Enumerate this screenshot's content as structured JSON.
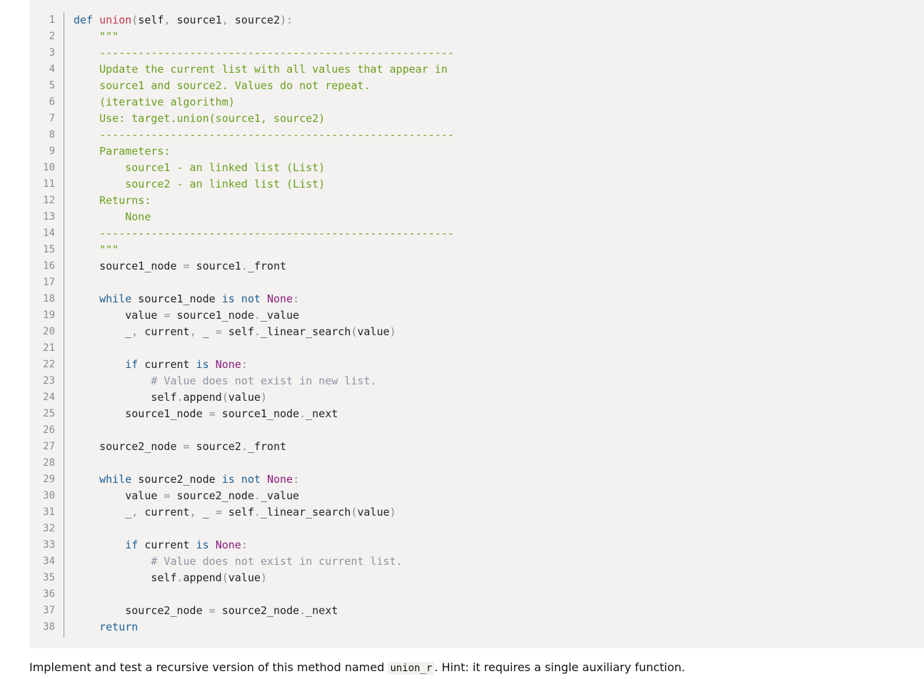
{
  "code": {
    "lines": [
      {
        "n": "1",
        "segs": [
          [
            "kw",
            "def "
          ],
          [
            "fn",
            "union"
          ],
          [
            "pun",
            "("
          ],
          [
            "txt",
            "self"
          ],
          [
            "pun",
            ", "
          ],
          [
            "txt",
            "source1"
          ],
          [
            "pun",
            ", "
          ],
          [
            "txt",
            "source2"
          ],
          [
            "pun",
            "):"
          ]
        ]
      },
      {
        "n": "2",
        "segs": [
          [
            "str",
            "    \"\"\""
          ]
        ]
      },
      {
        "n": "3",
        "segs": [
          [
            "str",
            "    -------------------------------------------------------"
          ]
        ]
      },
      {
        "n": "4",
        "segs": [
          [
            "str",
            "    Update the current list with all values that appear in"
          ]
        ]
      },
      {
        "n": "5",
        "segs": [
          [
            "str",
            "    source1 and source2. Values do not repeat."
          ]
        ]
      },
      {
        "n": "6",
        "segs": [
          [
            "str",
            "    (iterative algorithm)"
          ]
        ]
      },
      {
        "n": "7",
        "segs": [
          [
            "str",
            "    Use: target.union(source1, source2)"
          ]
        ]
      },
      {
        "n": "8",
        "segs": [
          [
            "str",
            "    -------------------------------------------------------"
          ]
        ]
      },
      {
        "n": "9",
        "segs": [
          [
            "str",
            "    Parameters:"
          ]
        ]
      },
      {
        "n": "10",
        "segs": [
          [
            "str",
            "        source1 - an linked list (List)"
          ]
        ]
      },
      {
        "n": "11",
        "segs": [
          [
            "str",
            "        source2 - an linked list (List)"
          ]
        ]
      },
      {
        "n": "12",
        "segs": [
          [
            "str",
            "    Returns:"
          ]
        ]
      },
      {
        "n": "13",
        "segs": [
          [
            "str",
            "        None"
          ]
        ]
      },
      {
        "n": "14",
        "segs": [
          [
            "str",
            "    -------------------------------------------------------"
          ]
        ]
      },
      {
        "n": "15",
        "segs": [
          [
            "str",
            "    \"\"\""
          ]
        ]
      },
      {
        "n": "16",
        "segs": [
          [
            "txt",
            "    source1_node "
          ],
          [
            "pun",
            "="
          ],
          [
            "txt",
            " source1"
          ],
          [
            "pun",
            "."
          ],
          [
            "txt",
            "_front"
          ]
        ]
      },
      {
        "n": "17",
        "segs": []
      },
      {
        "n": "18",
        "segs": [
          [
            "kw",
            "    while"
          ],
          [
            "txt",
            " source1_node "
          ],
          [
            "kw",
            "is not"
          ],
          [
            "txt",
            " "
          ],
          [
            "cst",
            "None"
          ],
          [
            "pun",
            ":"
          ]
        ]
      },
      {
        "n": "19",
        "segs": [
          [
            "txt",
            "        value "
          ],
          [
            "pun",
            "="
          ],
          [
            "txt",
            " source1_node"
          ],
          [
            "pun",
            "."
          ],
          [
            "txt",
            "_value"
          ]
        ]
      },
      {
        "n": "20",
        "segs": [
          [
            "txt",
            "        _"
          ],
          [
            "pun",
            ","
          ],
          [
            "txt",
            " current"
          ],
          [
            "pun",
            ","
          ],
          [
            "txt",
            " _ "
          ],
          [
            "pun",
            "="
          ],
          [
            "txt",
            " self"
          ],
          [
            "pun",
            "."
          ],
          [
            "txt",
            "_linear_search"
          ],
          [
            "pun",
            "("
          ],
          [
            "txt",
            "value"
          ],
          [
            "pun",
            ")"
          ]
        ]
      },
      {
        "n": "21",
        "segs": []
      },
      {
        "n": "22",
        "segs": [
          [
            "kw",
            "        if"
          ],
          [
            "txt",
            " current "
          ],
          [
            "kw",
            "is"
          ],
          [
            "txt",
            " "
          ],
          [
            "cst",
            "None"
          ],
          [
            "pun",
            ":"
          ]
        ]
      },
      {
        "n": "23",
        "segs": [
          [
            "cmt",
            "            # Value does not exist in new list."
          ]
        ]
      },
      {
        "n": "24",
        "segs": [
          [
            "txt",
            "            self"
          ],
          [
            "pun",
            "."
          ],
          [
            "txt",
            "append"
          ],
          [
            "pun",
            "("
          ],
          [
            "txt",
            "value"
          ],
          [
            "pun",
            ")"
          ]
        ]
      },
      {
        "n": "25",
        "segs": [
          [
            "txt",
            "        source1_node "
          ],
          [
            "pun",
            "="
          ],
          [
            "txt",
            " source1_node"
          ],
          [
            "pun",
            "."
          ],
          [
            "txt",
            "_next"
          ]
        ]
      },
      {
        "n": "26",
        "segs": []
      },
      {
        "n": "27",
        "segs": [
          [
            "txt",
            "    source2_node "
          ],
          [
            "pun",
            "="
          ],
          [
            "txt",
            " source2"
          ],
          [
            "pun",
            "."
          ],
          [
            "txt",
            "_front"
          ]
        ]
      },
      {
        "n": "28",
        "segs": []
      },
      {
        "n": "29",
        "segs": [
          [
            "kw",
            "    while"
          ],
          [
            "txt",
            " source2_node "
          ],
          [
            "kw",
            "is not"
          ],
          [
            "txt",
            " "
          ],
          [
            "cst",
            "None"
          ],
          [
            "pun",
            ":"
          ]
        ]
      },
      {
        "n": "30",
        "segs": [
          [
            "txt",
            "        value "
          ],
          [
            "pun",
            "="
          ],
          [
            "txt",
            " source2_node"
          ],
          [
            "pun",
            "."
          ],
          [
            "txt",
            "_value"
          ]
        ]
      },
      {
        "n": "31",
        "segs": [
          [
            "txt",
            "        _"
          ],
          [
            "pun",
            ","
          ],
          [
            "txt",
            " current"
          ],
          [
            "pun",
            ","
          ],
          [
            "txt",
            " _ "
          ],
          [
            "pun",
            "="
          ],
          [
            "txt",
            " self"
          ],
          [
            "pun",
            "."
          ],
          [
            "txt",
            "_linear_search"
          ],
          [
            "pun",
            "("
          ],
          [
            "txt",
            "value"
          ],
          [
            "pun",
            ")"
          ]
        ]
      },
      {
        "n": "32",
        "segs": []
      },
      {
        "n": "33",
        "segs": [
          [
            "kw",
            "        if"
          ],
          [
            "txt",
            " current "
          ],
          [
            "kw",
            "is"
          ],
          [
            "txt",
            " "
          ],
          [
            "cst",
            "None"
          ],
          [
            "pun",
            ":"
          ]
        ]
      },
      {
        "n": "34",
        "segs": [
          [
            "cmt",
            "            # Value does not exist in current list."
          ]
        ]
      },
      {
        "n": "35",
        "segs": [
          [
            "txt",
            "            self"
          ],
          [
            "pun",
            "."
          ],
          [
            "txt",
            "append"
          ],
          [
            "pun",
            "("
          ],
          [
            "txt",
            "value"
          ],
          [
            "pun",
            ")"
          ]
        ]
      },
      {
        "n": "36",
        "segs": []
      },
      {
        "n": "37",
        "segs": [
          [
            "txt",
            "        source2_node "
          ],
          [
            "pun",
            "="
          ],
          [
            "txt",
            " source2_node"
          ],
          [
            "pun",
            "."
          ],
          [
            "txt",
            "_next"
          ]
        ]
      },
      {
        "n": "38",
        "segs": [
          [
            "kw",
            "    return"
          ]
        ]
      }
    ]
  },
  "caption": {
    "before": "Implement and test a recursive version of this method named ",
    "code": "union_r",
    "after": ". Hint: it requires a single auxiliary function."
  },
  "colors": {
    "keyword": "#1a5e96",
    "function_name": "#c4344f",
    "constant": "#8a1a7a",
    "docstring": "#6a9e1e",
    "comment": "#8b95a3",
    "code_background": "#f4f2f0"
  }
}
